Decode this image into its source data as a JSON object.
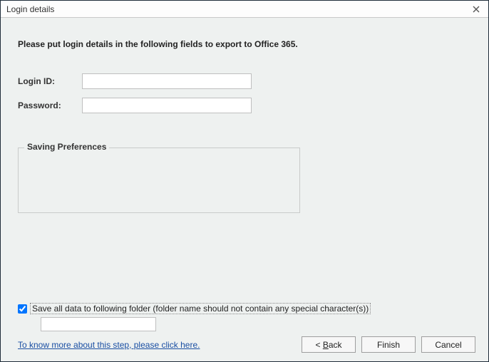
{
  "window": {
    "title": "Login details"
  },
  "instruction": "Please put login details in the following fields to export to Office 365.",
  "form": {
    "login_label": "Login ID:",
    "login_value": "",
    "password_label": "Password:",
    "password_value": ""
  },
  "preferences": {
    "legend": "Saving Preferences"
  },
  "save_option": {
    "checked": true,
    "label": "Save all data to following folder (folder name should not contain any special character(s))",
    "folder_value": ""
  },
  "help_link": "To know more about this step, please click here.",
  "buttons": {
    "back_prefix": "< ",
    "back_accel": "B",
    "back_rest": "ack",
    "finish": "Finish",
    "cancel": "Cancel"
  }
}
